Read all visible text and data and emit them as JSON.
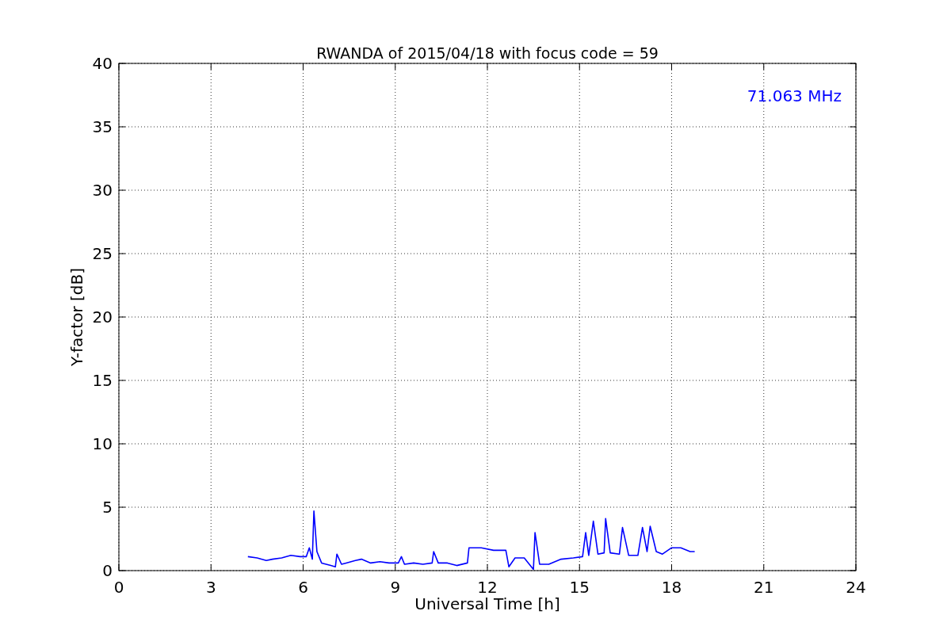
{
  "chart_data": {
    "type": "line",
    "title": "RWANDA of 2015/04/18 with focus code = 59",
    "xlabel": "Universal Time [h]",
    "ylabel": "Y-factor [dB]",
    "x": [
      4.2,
      4.5,
      4.8,
      5.0,
      5.3,
      5.6,
      5.9,
      6.1,
      6.2,
      6.3,
      6.35,
      6.45,
      6.6,
      6.9,
      7.05,
      7.1,
      7.25,
      7.4,
      7.7,
      7.9,
      8.2,
      8.5,
      8.8,
      9.1,
      9.2,
      9.3,
      9.6,
      9.9,
      10.2,
      10.25,
      10.4,
      10.7,
      11.0,
      11.35,
      11.4,
      11.8,
      12.2,
      12.6,
      12.7,
      12.9,
      13.2,
      13.5,
      13.55,
      13.7,
      14.0,
      14.4,
      14.8,
      15.1,
      15.2,
      15.3,
      15.45,
      15.6,
      15.8,
      15.85,
      16.0,
      16.3,
      16.4,
      16.6,
      16.9,
      17.05,
      17.2,
      17.3,
      17.5,
      17.7,
      18.0,
      18.3,
      18.6,
      18.75
    ],
    "series": [
      {
        "name": "71.063 MHz",
        "color": "#0000ff",
        "values": [
          1.1,
          1.0,
          0.8,
          0.9,
          1.0,
          1.2,
          1.1,
          1.1,
          1.8,
          0.9,
          4.7,
          1.5,
          0.6,
          0.4,
          0.3,
          1.3,
          0.5,
          0.6,
          0.8,
          0.9,
          0.6,
          0.7,
          0.6,
          0.6,
          1.1,
          0.5,
          0.6,
          0.5,
          0.6,
          1.5,
          0.6,
          0.6,
          0.4,
          0.6,
          1.8,
          1.8,
          1.6,
          1.6,
          0.3,
          1.0,
          1.0,
          0.1,
          3.0,
          0.5,
          0.5,
          0.9,
          1.0,
          1.1,
          3.0,
          1.2,
          3.9,
          1.3,
          1.4,
          4.1,
          1.4,
          1.3,
          3.4,
          1.2,
          1.2,
          3.4,
          1.5,
          3.5,
          1.5,
          1.3,
          1.8,
          1.8,
          1.5,
          1.5
        ]
      }
    ],
    "xlim": [
      0,
      24
    ],
    "ylim": [
      0,
      40
    ],
    "xticks": [
      0,
      3,
      6,
      9,
      12,
      15,
      18,
      21,
      24
    ],
    "yticks": [
      0,
      5,
      10,
      15,
      20,
      25,
      30,
      35,
      40
    ],
    "grid": true
  }
}
